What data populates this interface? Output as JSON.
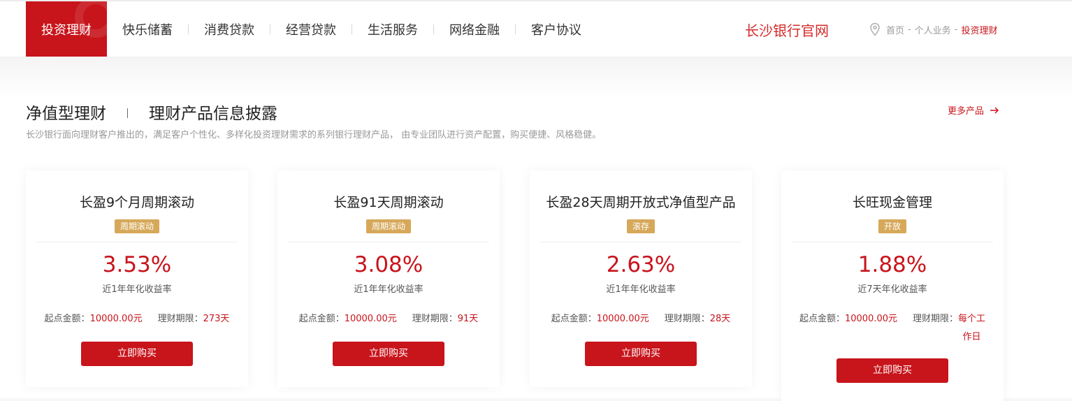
{
  "nav": {
    "items": [
      "投资理财",
      "快乐储蓄",
      "消费贷款",
      "经营贷款",
      "生活服务",
      "网络金融",
      "客户协议"
    ],
    "active_index": 0
  },
  "header": {
    "site_title": "长沙银行官网",
    "breadcrumb": [
      "首页",
      "个人业务",
      "投资理财"
    ],
    "breadcrumb_separator": "-"
  },
  "section": {
    "tab_primary": "净值型理财",
    "tab_secondary": "理财产品信息披露",
    "more_label": "更多产品",
    "description": "长沙银行面向理财客户推出的，满足客户个性化、多样化投资理财需求的系列银行理财产品， 由专业团队进行资产配置，购买便捷、风格稳健。"
  },
  "labels": {
    "min_amount": "起点金额：",
    "term": "理财期限：",
    "buy": "立即购买"
  },
  "products": [
    {
      "name": "长盈9个月周期滚动",
      "badge": "周期滚动",
      "rate": "3.53%",
      "rate_label": "近1年年化收益率",
      "min_amount": "10000.00元",
      "term_line1": "273天",
      "term_line2": ""
    },
    {
      "name": "长盈91天周期滚动",
      "badge": "周期滚动",
      "rate": "3.08%",
      "rate_label": "近1年年化收益率",
      "min_amount": "10000.00元",
      "term_line1": "91天",
      "term_line2": ""
    },
    {
      "name": "长盈28天周期开放式净值型产品",
      "badge": "滚存",
      "rate": "2.63%",
      "rate_label": "近1年年化收益率",
      "min_amount": "10000.00元",
      "term_line1": "28天",
      "term_line2": ""
    },
    {
      "name": "长旺现金管理",
      "badge": "开放",
      "rate": "1.88%",
      "rate_label": "近7天年化收益率",
      "min_amount": "10000.00元",
      "term_line1": "每个工",
      "term_line2": "作日"
    }
  ],
  "colors": {
    "brand_red": "#c8141b",
    "title_red": "#d42b2b",
    "badge_gold": "#d6a85a"
  }
}
